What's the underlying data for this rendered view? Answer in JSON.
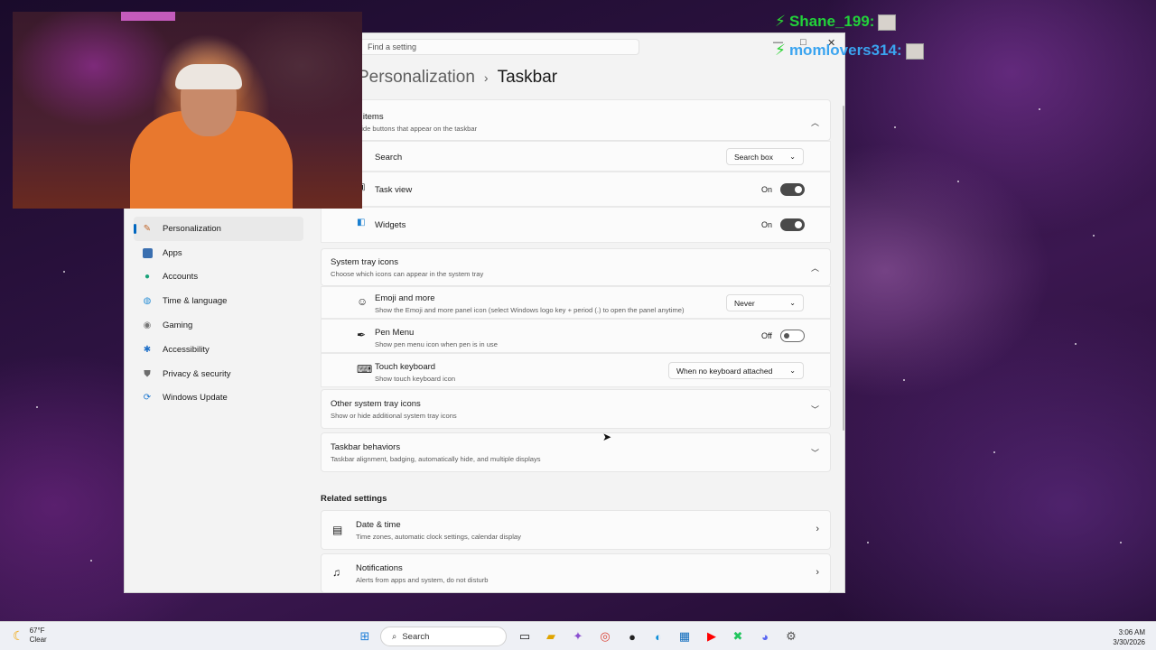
{
  "window": {
    "search_placeholder": "Find a setting",
    "breadcrumb_parent": "Personalization",
    "breadcrumb_sep": "›",
    "breadcrumb_current": "Taskbar"
  },
  "nav": {
    "items": [
      {
        "label": "Personalization",
        "icon": "brush-icon"
      },
      {
        "label": "Apps",
        "icon": "apps-icon"
      },
      {
        "label": "Accounts",
        "icon": "person-icon"
      },
      {
        "label": "Time & language",
        "icon": "globe-icon"
      },
      {
        "label": "Gaming",
        "icon": "gamepad-icon"
      },
      {
        "label": "Accessibility",
        "icon": "accessibility-icon"
      },
      {
        "label": "Privacy & security",
        "icon": "shield-icon"
      },
      {
        "label": "Windows Update",
        "icon": "update-icon"
      }
    ]
  },
  "taskbar_items": {
    "title": "Taskbar items",
    "subtitle": "Show or hide buttons that appear on the taskbar",
    "search_label": "Search",
    "search_value": "Search box",
    "taskview_label": "Task view",
    "taskview_state": "On",
    "widgets_label": "Widgets",
    "widgets_state": "On"
  },
  "tray": {
    "title": "System tray icons",
    "subtitle": "Choose which icons can appear in the system tray",
    "emoji_label": "Emoji and more",
    "emoji_sub": "Show the Emoji and more panel icon (select Windows logo key + period (.) to open the panel anytime)",
    "emoji_value": "Never",
    "pen_label": "Pen Menu",
    "pen_sub": "Show pen menu icon when pen is in use",
    "pen_state": "Off",
    "touch_label": "Touch keyboard",
    "touch_sub": "Show touch keyboard icon",
    "touch_value": "When no keyboard attached"
  },
  "other_tray": {
    "title": "Other system tray icons",
    "subtitle": "Show or hide additional system tray icons"
  },
  "behaviors": {
    "title": "Taskbar behaviors",
    "subtitle": "Taskbar alignment, badging, automatically hide, and multiple displays"
  },
  "related": {
    "heading": "Related settings",
    "datetime_title": "Date & time",
    "datetime_sub": "Time zones, automatic clock settings, calendar display",
    "notif_title": "Notifications",
    "notif_sub": "Alerts from apps and system, do not disturb"
  },
  "chat": {
    "user1": "Shane_199:",
    "user2": "momlovers314:"
  },
  "os_taskbar": {
    "weather_temp": "67°F",
    "weather_cond": "Clear",
    "search_label": "Search",
    "time": "3:06 AM",
    "date": "3/30/2026"
  },
  "colors": {
    "accent": "#0067c0",
    "toggle_on": "#4a4a4a"
  }
}
